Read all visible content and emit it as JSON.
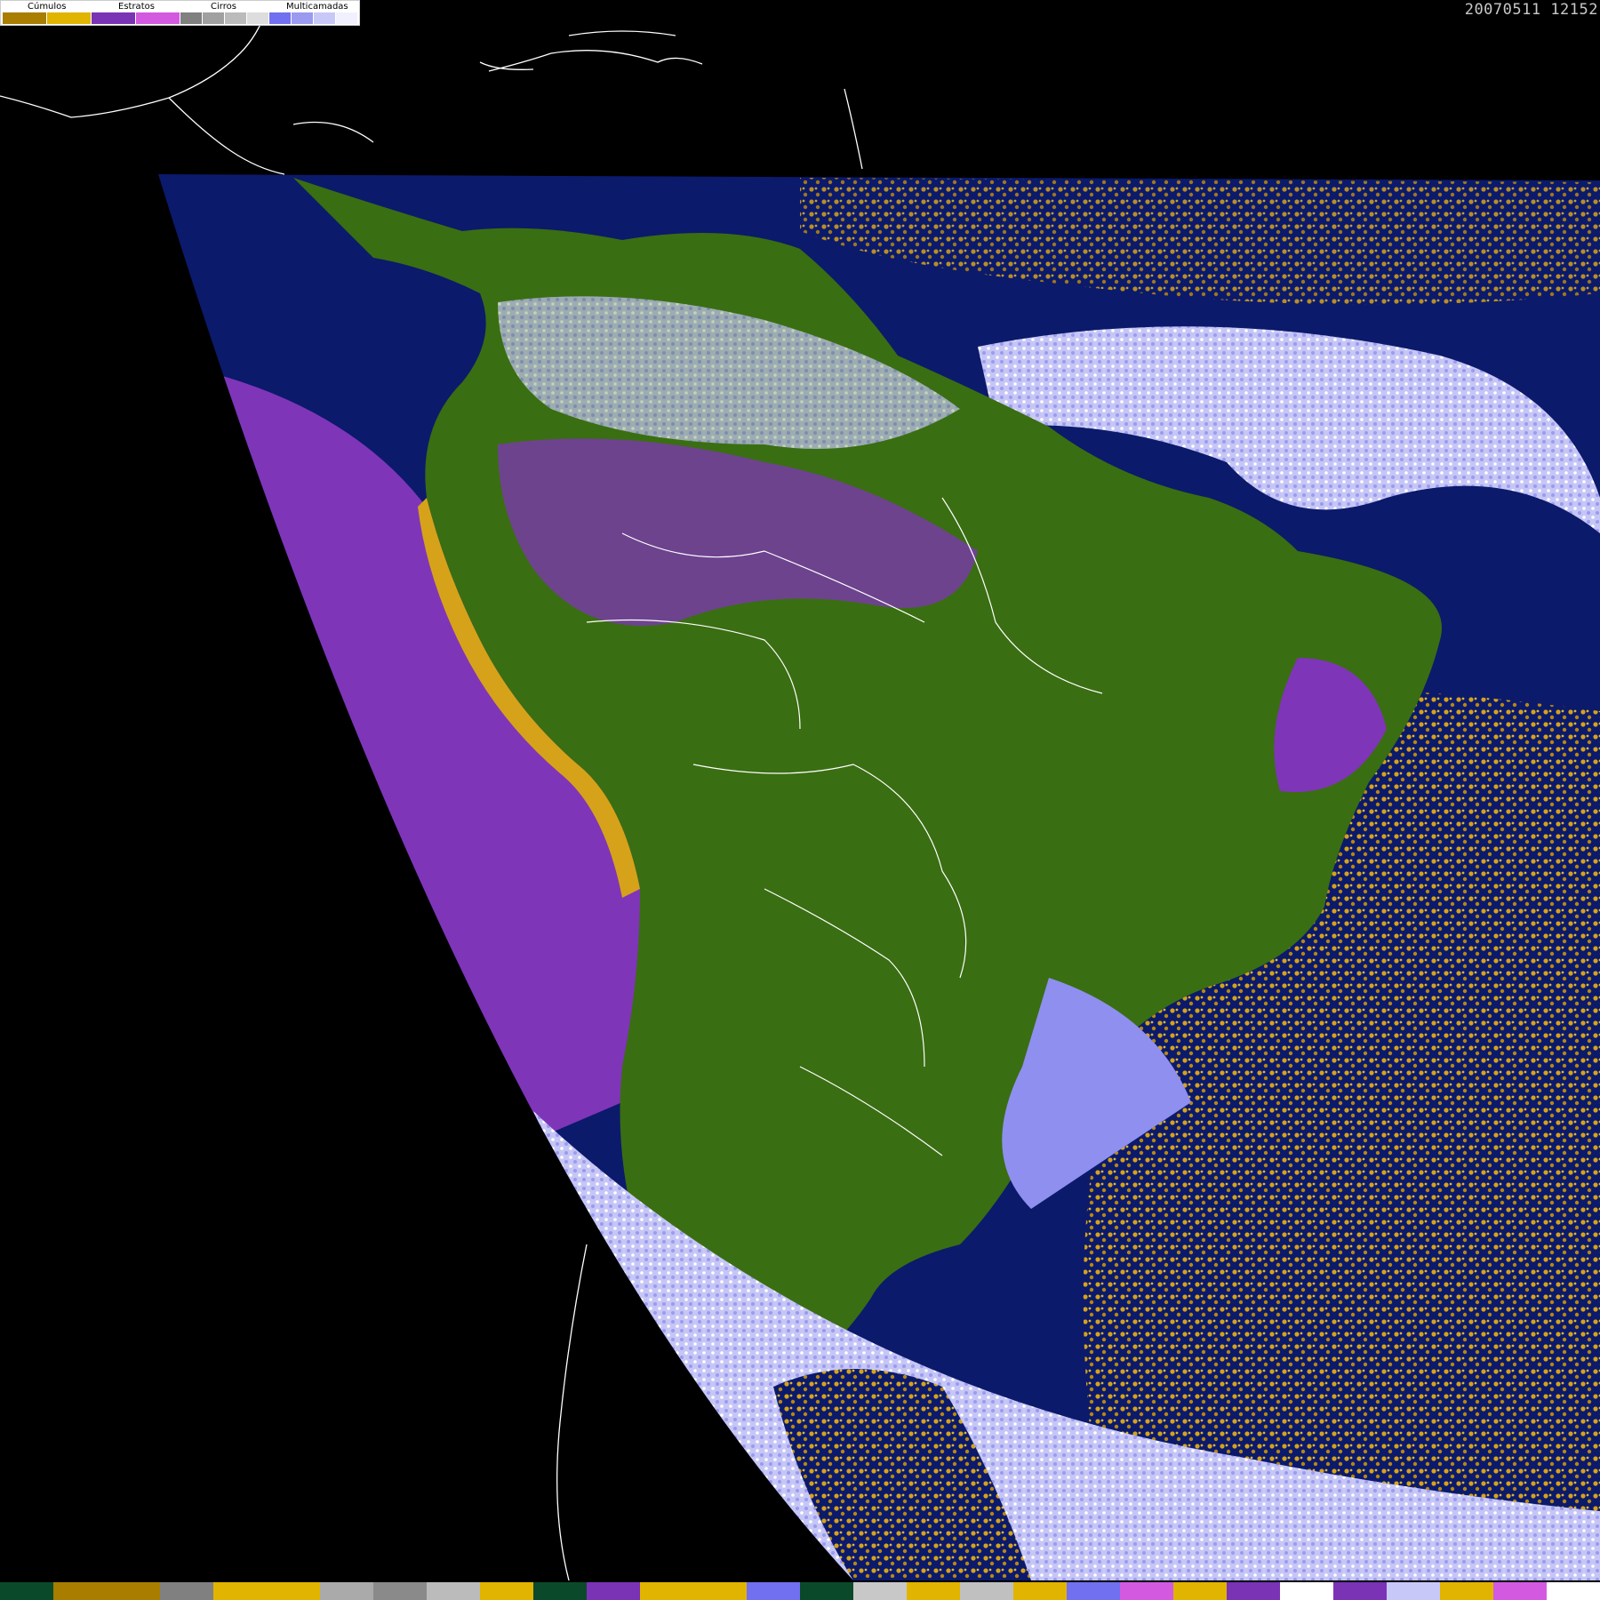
{
  "timestamp": "20070511 12152",
  "legend": {
    "groups": [
      {
        "label": "Cúmulos",
        "swatches": [
          "#a87d00",
          "#e0b400"
        ]
      },
      {
        "label": "Estratos",
        "swatches": [
          "#7a33b5",
          "#d35ae0"
        ]
      },
      {
        "label": "Cirros",
        "swatches": [
          "#808080",
          "#a0a0a0",
          "#bbbbbb",
          "#dddddd"
        ]
      },
      {
        "label": "Multicamadas",
        "swatches": [
          "#7070f0",
          "#9a9af0",
          "#c8c8f8",
          "#f0f0ff"
        ]
      }
    ]
  },
  "map": {
    "description_colors": {
      "background": "#000000",
      "ocean": "#0b1a6b",
      "land": "#3a6e12",
      "stratus": "#7f35b8",
      "cumulus": "#d6a21a",
      "multilayer": "#c6c6f6",
      "borders": "#ffffff"
    }
  },
  "bottom_strip": [
    "#0a4a2a",
    "#a87d00",
    "#a87d00",
    "#808080",
    "#e0b400",
    "#e0b400",
    "#aaaaaa",
    "#8a8a8a",
    "#bbbbbb",
    "#e0b400",
    "#0a4a2a",
    "#7a33b5",
    "#e0b400",
    "#e0b400",
    "#7070f0",
    "#0a4a2a",
    "#c8c8c8",
    "#e0b400",
    "#c0c0c0",
    "#e0b400",
    "#7070f0",
    "#d35ae0",
    "#e0b400",
    "#7a33b5",
    "#ffffff",
    "#7a33b5",
    "#c8c8f8",
    "#e0b400",
    "#d35ae0",
    "#ffffff"
  ]
}
